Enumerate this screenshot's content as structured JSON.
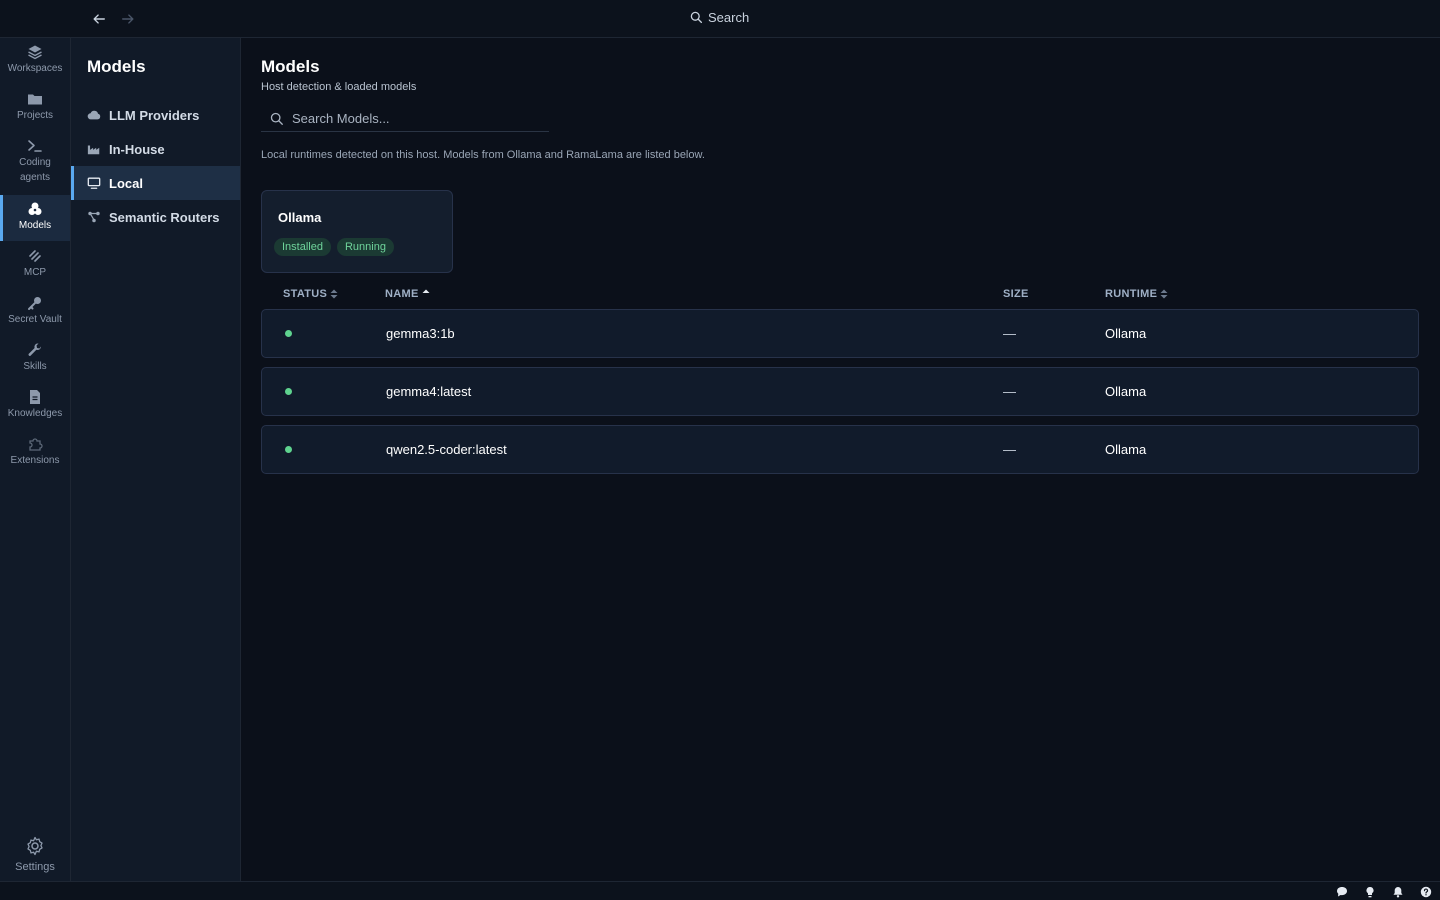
{
  "topbar": {
    "search_label": "Search"
  },
  "rail": {
    "items": [
      {
        "label": "Workspaces",
        "icon": "layers-icon"
      },
      {
        "label": "Projects",
        "icon": "folder-icon"
      },
      {
        "label": "Coding agents",
        "icon": "terminal-icon"
      },
      {
        "label": "Models",
        "icon": "models-icon"
      },
      {
        "label": "MCP",
        "icon": "mcp-icon"
      },
      {
        "label": "Secret Vault",
        "icon": "key-icon"
      },
      {
        "label": "Skills",
        "icon": "wrench-icon"
      },
      {
        "label": "Knowledges",
        "icon": "document-icon"
      },
      {
        "label": "Extensions",
        "icon": "puzzle-icon"
      }
    ],
    "settings_label": "Settings"
  },
  "subnav": {
    "title": "Models",
    "items": [
      {
        "label": "LLM Providers",
        "icon": "cloud-icon"
      },
      {
        "label": "In-House",
        "icon": "factory-icon"
      },
      {
        "label": "Local",
        "icon": "monitor-icon"
      },
      {
        "label": "Semantic Routers",
        "icon": "router-icon"
      }
    ],
    "active": "Local"
  },
  "main": {
    "title": "Models",
    "subtitle": "Host detection & loaded models",
    "search_placeholder": "Search Models...",
    "info": "Local runtimes detected on this host. Models from Ollama and RamaLama are listed below.",
    "runtime_card": {
      "name": "Ollama",
      "badges": [
        "Installed",
        "Running"
      ]
    },
    "table": {
      "columns": [
        "STATUS",
        "NAME",
        "SIZE",
        "RUNTIME"
      ],
      "rows": [
        {
          "status": "running",
          "name": "gemma3:1b",
          "size": "—",
          "runtime": "Ollama"
        },
        {
          "status": "running",
          "name": "gemma4:latest",
          "size": "—",
          "runtime": "Ollama"
        },
        {
          "status": "running",
          "name": "qwen2.5-coder:latest",
          "size": "—",
          "runtime": "Ollama"
        }
      ]
    }
  },
  "colors": {
    "accent": "#5aa9f0",
    "status_green": "#5fd38f",
    "background": "#0b101a"
  }
}
